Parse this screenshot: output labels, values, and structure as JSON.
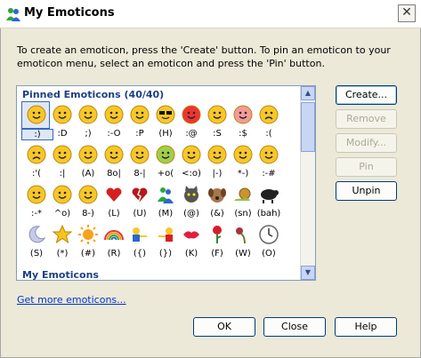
{
  "window": {
    "title": "My Emoticons"
  },
  "intro": "To create an emoticon, press the 'Create' button.  To pin an emoticon to your emoticon menu, select an emoticon and press the 'Pin' button.",
  "list": {
    "pinned_title": "Pinned Emoticons (40/40)",
    "my_title": "My Emoticons",
    "rows": [
      [
        {
          "icon": "smile-face-icon",
          "code": ":)"
        },
        {
          "icon": "big-grin-icon",
          "code": ":D"
        },
        {
          "icon": "wink-icon",
          "code": ";)"
        },
        {
          "icon": "surprised-icon",
          "code": ":-O"
        },
        {
          "icon": "tongue-out-icon",
          "code": ":P"
        },
        {
          "icon": "sunglasses-face-icon",
          "code": "(H)"
        },
        {
          "icon": "angry-face-icon",
          "code": ":@"
        },
        {
          "icon": "confused-face-icon",
          "code": ":S"
        },
        {
          "icon": "embarrassed-face-icon",
          "code": ":$"
        },
        {
          "icon": "sad-face-icon",
          "code": ":("
        }
      ],
      [
        {
          "icon": "crying-face-icon",
          "code": ":'("
        },
        {
          "icon": "disappointed-face-icon",
          "code": ":|"
        },
        {
          "icon": "angel-face-icon",
          "code": "(A)"
        },
        {
          "icon": "baring-teeth-icon",
          "code": "8o|"
        },
        {
          "icon": "nerd-face-icon",
          "code": "8-|"
        },
        {
          "icon": "sick-face-icon",
          "code": "+o("
        },
        {
          "icon": "party-face-icon",
          "code": "<:o)"
        },
        {
          "icon": "sleepy-face-icon",
          "code": "|-)"
        },
        {
          "icon": "thinking-face-icon",
          "code": "*-)"
        },
        {
          "icon": "dont-tell-face-icon",
          "code": ":-#"
        }
      ],
      [
        {
          "icon": "secret-telling-icon",
          "code": ":-*"
        },
        {
          "icon": "eye-rolling-icon",
          "code": "^o)"
        },
        {
          "icon": "sarcastic-face-icon",
          "code": "8-)"
        },
        {
          "icon": "red-heart-icon",
          "code": "(L)"
        },
        {
          "icon": "broken-heart-icon",
          "code": "(U)"
        },
        {
          "icon": "messenger-icon",
          "code": "(M)"
        },
        {
          "icon": "cat-face-icon",
          "code": "(@)"
        },
        {
          "icon": "dog-face-icon",
          "code": "(&)"
        },
        {
          "icon": "snail-icon",
          "code": "(sn)"
        },
        {
          "icon": "black-sheep-icon",
          "code": "(bah)"
        }
      ],
      [
        {
          "icon": "sleeping-moon-icon",
          "code": "(S)"
        },
        {
          "icon": "star-icon",
          "code": "(*)"
        },
        {
          "icon": "sun-icon",
          "code": "(#)"
        },
        {
          "icon": "rainbow-icon",
          "code": "(R)"
        },
        {
          "icon": "hug-left-icon",
          "code": "({)"
        },
        {
          "icon": "hug-right-icon",
          "code": "(})"
        },
        {
          "icon": "red-lips-icon",
          "code": "(K)"
        },
        {
          "icon": "red-rose-icon",
          "code": "(F)"
        },
        {
          "icon": "wilted-rose-icon",
          "code": "(W)"
        },
        {
          "icon": "clock-icon",
          "code": "(O)"
        }
      ]
    ]
  },
  "buttons": {
    "create": "Create...",
    "remove": "Remove",
    "modify": "Modify...",
    "pin": "Pin",
    "unpin": "Unpin",
    "ok": "OK",
    "close": "Close",
    "help": "Help"
  },
  "link": "Get more emoticons...",
  "colors": {
    "accent": "#316ac5",
    "face_yellow": "#f7c72a",
    "link": "#0033cc",
    "section_title": "#1d3f86"
  }
}
